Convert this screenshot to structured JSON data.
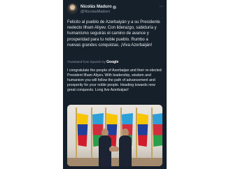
{
  "author": {
    "display_name": "Nicolás Maduro",
    "handle": "@NicolasMaduro",
    "verified": true,
    "avatar_icon": "user-avatar"
  },
  "tweet": {
    "text": "Felicito al pueblo de Azerbaiyán y a su Presidente reelecto Ilham Aliyev. Con liderazgo, sabiduría y humanismo seguirás el camino de avance y prosperidad para tu noble pueblo. Rumbo a nuevas grandes conquistas. ¡Viva Azerbaiján!",
    "translated_by_label": "Translated from Spanish by",
    "translation_provider": "Google",
    "translation": "I congratulate the people of Azerbaijan and their re-elected President Ilham Aliyev. With leadership, wisdom and humanism you will follow the path of advancement and prosperity for your noble people. Heading towards new great conquests. Long live Azerbaijan!"
  },
  "colors": {
    "background": "#15202b",
    "text": "#e7e9ea",
    "muted": "#8b98a5"
  }
}
